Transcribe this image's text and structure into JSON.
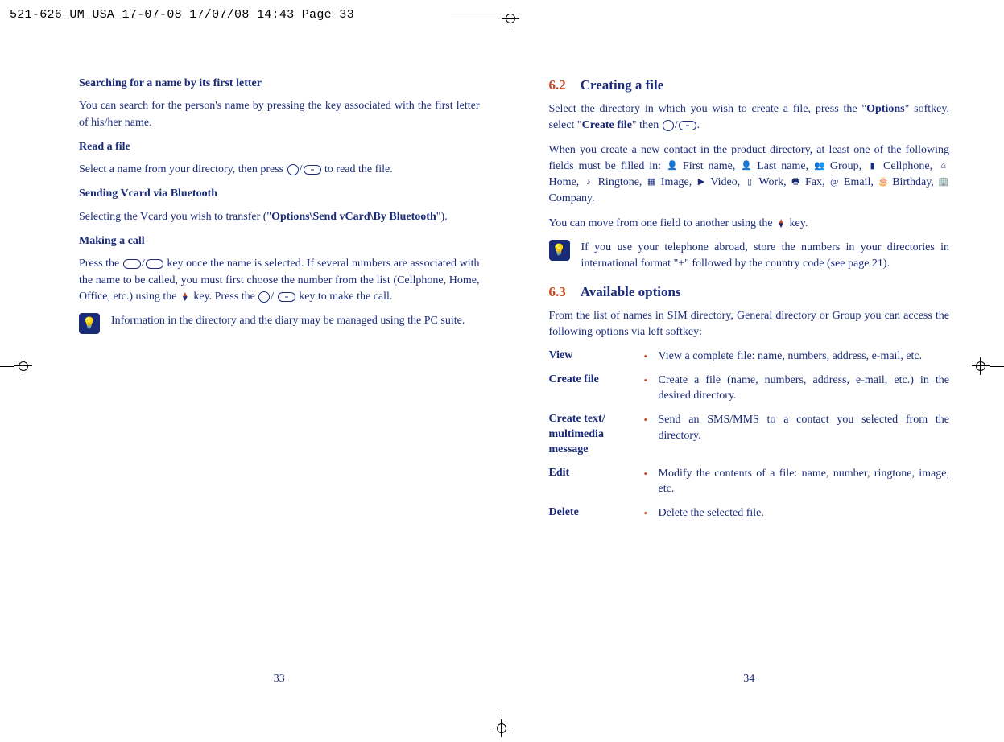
{
  "header": "521-626_UM_USA_17-07-08  17/07/08  14:43  Page 33",
  "left": {
    "h1": "Searching for a name by its first letter",
    "p1": "You can search for the person's name by pressing the key associated with the first letter of his/her name.",
    "h2": "Read a file",
    "p2a": "Select a name from your directory, then press ",
    "p2b": " to read the file.",
    "h3": "Sending Vcard via Bluetooth",
    "p3a": "Selecting the Vcard you wish to transfer (\"",
    "p3b": "Options\\Send vCard\\By Bluetooth",
    "p3c": "\").",
    "h4": "Making a call",
    "p4a": "Press the ",
    "p4b": " key once the name is selected. If several numbers are associated with the name to be called, you must first choose the number from the list (Cellphone, Home, Office, etc.) using the ",
    "p4c": " key. Press the ",
    "p4d": " key to make the call.",
    "tip": "Information in the directory and the diary may be managed using the PC suite.",
    "pagenum": "33"
  },
  "right": {
    "s62num": "6.2",
    "s62title": "Creating a file",
    "p1a": "Select the directory in which you wish to create a file, press the \"",
    "p1b": "Options",
    "p1c": "\" softkey, select \"",
    "p1d": "Create file",
    "p1e": "\" then ",
    "p2a": "When you create a new contact in the product directory, at least one of the following fields must be filled in: ",
    "fFirst": " First name, ",
    "fLast": " Last name, ",
    "fGroup": " Group, ",
    "fCell": " Cellphone, ",
    "fHome": "Home, ",
    "fRing": " Ringtone, ",
    "fImage": " Image, ",
    "fVideo": " Video, ",
    "fWork": " Work, ",
    "fFax": " Fax, ",
    "fEmail": " Email, ",
    "fBday": " Birthday, ",
    "fCompany": " Company.",
    "p3a": "You can move from one field to another using the ",
    "p3b": " key.",
    "tip": "If you use your telephone abroad, store the numbers in your directories in international format \"+\" followed by the country code (see page 21).",
    "s63num": "6.3",
    "s63title": "Available options",
    "p4": "From the list of names in SIM directory, General directory or Group you can access the following options via left softkey:",
    "opts": {
      "view": {
        "term": "View",
        "desc": "View a complete file: name, numbers, address, e-mail, etc."
      },
      "create": {
        "term": "Create file",
        "desc": "Create a file (name, numbers, address, e-mail, etc.) in the desired directory."
      },
      "msg": {
        "term": "Create text/ multimedia message",
        "desc": "Send an SMS/MMS to a contact you selected from the directory."
      },
      "edit": {
        "term": "Edit",
        "desc": "Modify the contents of a file: name, number, ringtone, image, etc."
      },
      "del": {
        "term": "Delete",
        "desc": "Delete the selected file."
      }
    },
    "pagenum": "34"
  }
}
